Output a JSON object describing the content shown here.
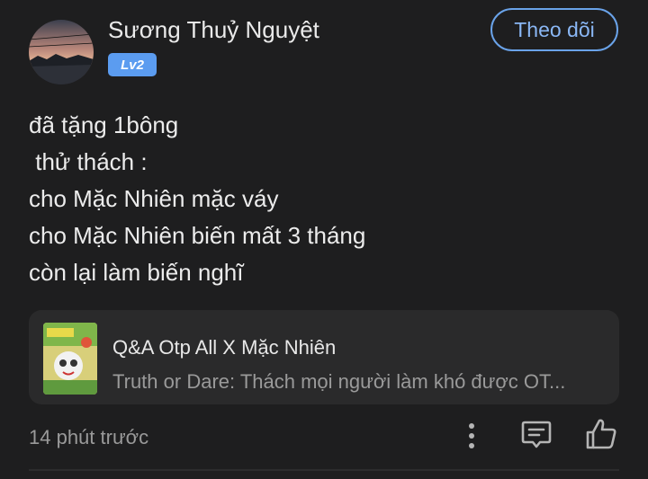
{
  "user": {
    "name": "Sương Thuỷ Nguyệt ",
    "level": "Lv2"
  },
  "follow_label": "Theo dõi",
  "content_lines": [
    "đã tặng 1bông",
    " thử thách :",
    "cho Mặc Nhiên mặc váy",
    "cho Mặc Nhiên biến mất 3 tháng",
    "còn lại làm biến nghĩ"
  ],
  "story": {
    "title": "Q&A Otp All X Mặc Nhiên",
    "description": "Truth or Dare: Thách mọi người làm khó được OT..."
  },
  "timestamp": "14 phút trước",
  "icons": {
    "more": "more-vertical-icon",
    "comment": "comment-icon",
    "like": "thumbs-up-icon"
  },
  "colors": {
    "background": "#1e1e1f",
    "accent": "#6aa3e9",
    "badge": "#5b9cf0"
  }
}
